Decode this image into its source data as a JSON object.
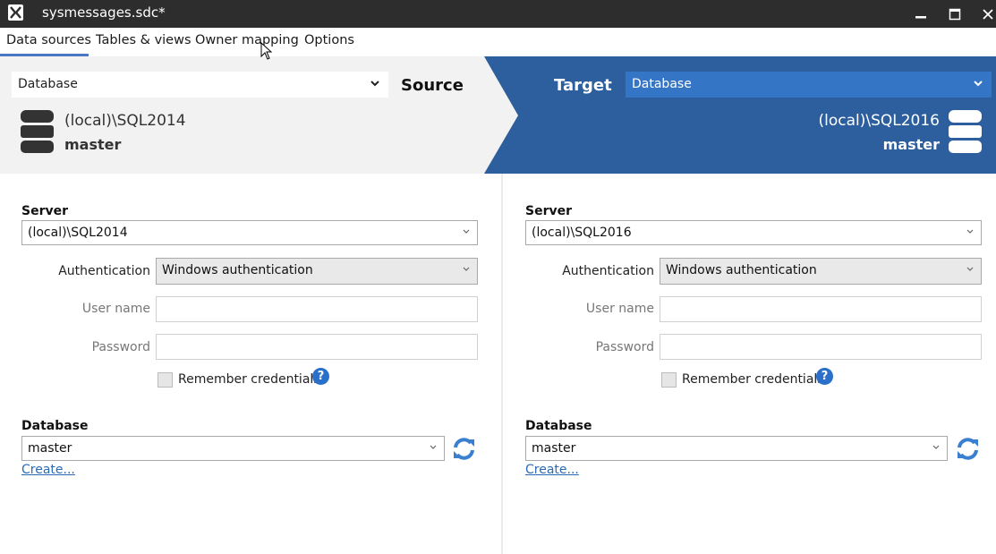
{
  "window": {
    "title": "sysmessages.sdc*",
    "logo_icon": "dbforge-logo-icon",
    "controls": [
      "minimize",
      "maximize",
      "close"
    ]
  },
  "tabs": [
    {
      "label": "Data sources",
      "active": true
    },
    {
      "label": "Tables & views",
      "active": false
    },
    {
      "label": "Owner mapping",
      "active": false
    },
    {
      "label": "Options",
      "active": false
    }
  ],
  "header": {
    "source": {
      "label": "Source",
      "type_select": "Database",
      "server": "(local)\\SQL2014",
      "database": "master"
    },
    "target": {
      "label": "Target",
      "type_select": "Database",
      "server": "(local)\\SQL2016",
      "database": "master"
    }
  },
  "colors": {
    "accent_blue": "#2d5f9e",
    "select_blue": "#3575c6",
    "tab_underline": "#4a78c2",
    "header_gray": "#f2f2f2",
    "link_blue": "#2a6ab5"
  },
  "source_panel": {
    "server_label": "Server",
    "server_value": "(local)\\SQL2014",
    "auth_label": "Authentication",
    "auth_value": "Windows authentication",
    "username_label": "User name",
    "username_value": "",
    "password_label": "Password",
    "password_value": "",
    "remember_label": "Remember credentials",
    "remember_checked": false,
    "database_label": "Database",
    "database_value": "master",
    "create_link": "Create..."
  },
  "target_panel": {
    "server_label": "Server",
    "server_value": "(local)\\SQL2016",
    "auth_label": "Authentication",
    "auth_value": "Windows authentication",
    "username_label": "User name",
    "username_value": "",
    "password_label": "Password",
    "password_value": "",
    "remember_label": "Remember credentials",
    "remember_checked": false,
    "database_label": "Database",
    "database_value": "master",
    "create_link": "Create..."
  }
}
